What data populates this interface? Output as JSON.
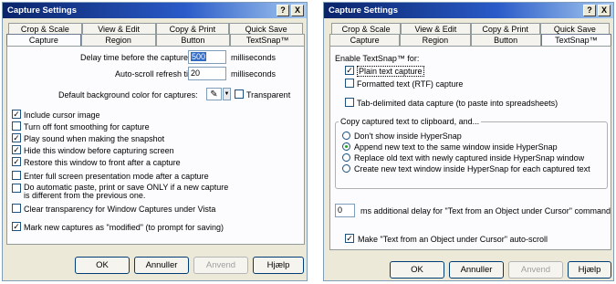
{
  "left": {
    "title": "Capture Settings",
    "titlebar_help": "?",
    "titlebar_close": "X",
    "tabs_back": [
      "Crop & Scale",
      "View & Edit",
      "Copy & Print",
      "Quick Save"
    ],
    "tabs_front": [
      "Capture",
      "Region",
      "Button",
      "TextSnap™"
    ],
    "delay_label": "Delay time before the capture:",
    "delay_value": "500",
    "delay_unit": "milliseconds",
    "scroll_label": "Auto-scroll refresh time:",
    "scroll_value": "20",
    "scroll_unit": "milliseconds",
    "bg_color_label": "Default background color for captures:",
    "transparent_label": "Transparent",
    "options": [
      {
        "label": "Include cursor image",
        "checked": true
      },
      {
        "label": "Turn off font smoothing for capture",
        "checked": false
      },
      {
        "label": "Play sound when making the snapshot",
        "checked": true
      },
      {
        "label": "Hide this window before capturing screen",
        "checked": true
      },
      {
        "label": "Restore this window to front after a capture",
        "checked": true
      },
      {
        "label": "Enter full screen presentation mode after a capture",
        "checked": false
      },
      {
        "label": "Do automatic paste, print or save ONLY if a new capture",
        "label2": "is different from the previous one.",
        "checked": false
      },
      {
        "label": "Clear transparency for Window Captures under Vista",
        "checked": false
      },
      {
        "label": "Mark new captures as \"modified\" (to prompt for saving)",
        "checked": true
      }
    ],
    "buttons": {
      "ok": "OK",
      "cancel": "Annuller",
      "apply": "Anvend",
      "help": "Hjælp"
    }
  },
  "right": {
    "title": "Capture Settings",
    "titlebar_help": "?",
    "titlebar_close": "X",
    "tabs_back": [
      "Crop & Scale",
      "View & Edit",
      "Copy & Print",
      "Quick Save"
    ],
    "tabs_front": [
      "Capture",
      "Region",
      "Button",
      "TextSnap™"
    ],
    "enable_label": "Enable TextSnap™ for:",
    "enable_options": [
      {
        "label": "Plain text capture",
        "checked": true
      },
      {
        "label": "Formatted text (RTF) capture",
        "checked": false
      }
    ],
    "tab_delim_label": "Tab-delimited data capture (to paste into spreadsheets)",
    "tab_delim_checked": false,
    "group_label": "Copy captured text to clipboard, and...",
    "radios": [
      {
        "label": "Don't show inside HyperSnap",
        "selected": false
      },
      {
        "label": "Append new text to the same window inside HyperSnap",
        "selected": true
      },
      {
        "label": "Replace old text with newly captured inside HyperSnap window",
        "selected": false
      },
      {
        "label": "Create new text window inside HyperSnap for each captured text",
        "selected": false
      }
    ],
    "delay_value": "0",
    "delay_label": "ms additional delay for \"Text from an Object under Cursor\" command",
    "autoscroll_label": "Make \"Text from an Object under Cursor\" auto-scroll",
    "autoscroll_checked": true,
    "buttons": {
      "ok": "OK",
      "cancel": "Annuller",
      "apply": "Anvend",
      "help": "Hjælp"
    }
  }
}
